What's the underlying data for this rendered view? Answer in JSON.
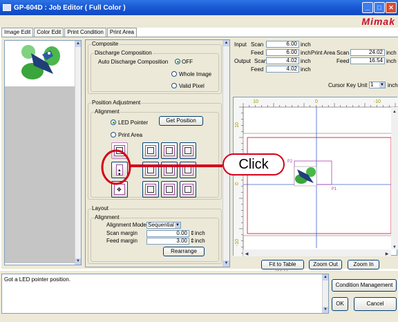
{
  "window": {
    "title": "GP-604D : Job Editor ( Full Color )"
  },
  "brand": {
    "logo_text": "Mimak"
  },
  "tabs": [
    {
      "label": "Image Edit"
    },
    {
      "label": "Color Edit"
    },
    {
      "label": "Print Condition"
    },
    {
      "label": "Print Area"
    }
  ],
  "composite": {
    "group_label": "Composite",
    "discharge_label": "Discharge Composition",
    "auto_label": "Auto Discharge Composition",
    "options": [
      {
        "label": "OFF"
      },
      {
        "label": "Whole Image"
      },
      {
        "label": "Valid Pixel"
      }
    ]
  },
  "position": {
    "group_label": "Position Adjustment",
    "alignment_label": "Alignment",
    "led_label": "LED Pointer",
    "print_area_label": "Print Area",
    "get_position": "Get Position"
  },
  "layout": {
    "group_label": "Layout",
    "alignment_label": "Alignment",
    "mode_label": "Alignment Mode",
    "mode_value": "Sequential",
    "scan_margin_label": "Scan margin",
    "scan_margin_value": "0.00",
    "feed_margin_label": "Feed margin",
    "feed_margin_value": "3.00",
    "unit": "inch",
    "rearrange": "Rearrange"
  },
  "info": {
    "input_label": "Input",
    "output_label": "Output",
    "scan_label": "Scan",
    "feed_label": "Feed",
    "input_scan": "6.00",
    "input_feed": "6.00",
    "output_scan": "4.02",
    "output_feed": "4.02",
    "unit": "inch",
    "print_area_label": "Print Area",
    "pa_scan": "24.02",
    "pa_feed": "16.54",
    "cursor_key_label": "Cursor Key Unit",
    "cursor_key_value": "1",
    "cursor_unit": "inch"
  },
  "ruler": {
    "top": [
      "10",
      "0",
      "-10"
    ],
    "left": [
      "10",
      "0",
      "-10"
    ]
  },
  "canvas_labels": {
    "p1": "P1",
    "p2": "P2"
  },
  "align_labels": {
    "p1": "P1",
    "p2": "P2"
  },
  "canvas_buttons": {
    "fit": "Fit to Table Width",
    "zoom_out": "Zoom Out",
    "zoom_in": "Zoom In"
  },
  "status": {
    "message": "Got a LED pointer position.",
    "condition_management": "Condition Management",
    "ok": "OK",
    "cancel": "Cancel"
  },
  "annotation": {
    "click_label": "Click",
    "color": "#d4001a"
  }
}
